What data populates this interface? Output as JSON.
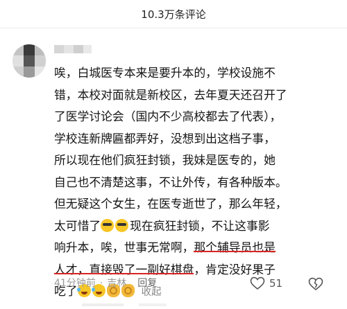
{
  "header": {
    "title": "10.3万条评论"
  },
  "comment": {
    "lines": [
      "唉，白城医专本来是要升本的，学校设施不",
      "错，本校对面就是新校区，去年夏天还召开了",
      "了医学讨论会（国内不少高校都去了代表），",
      "学校连新牌匾都弄好，没想到出这档子事，",
      "所以现在他们疯狂封锁，我妹是医专的，她",
      "自己也不清楚这事，不让外传，有各种版本。",
      "但无疑这个女生，在医专逝世了，那么年轻，",
      "太可惜了",
      "现在疯狂封锁，不让这事影",
      "响升本，唉，世事无常啊，",
      "那个辅导员也是",
      "人才，直接毁了一副好棋盘",
      "，肯定没好果子",
      "吃了"
    ],
    "collapse_label": "收起"
  },
  "meta": {
    "time": "41分钟前",
    "separator": "·",
    "location": "吉林",
    "reply_label": "回复"
  },
  "actions": {
    "like_count": "51",
    "like_icon": "heart-outline",
    "dislike_icon": "broken-heart-outline"
  },
  "icons": {
    "sunglasses": "sunglasses-emoji",
    "laugh": "tears-of-joy-emoji",
    "ok": "ok-hand-emoji"
  },
  "colors": {
    "underline": "#d8241f",
    "muted_text": "#999999"
  }
}
